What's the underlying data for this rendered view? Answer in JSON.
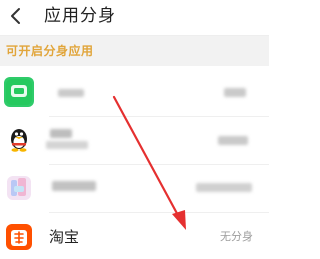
{
  "header": {
    "title": "应用分身",
    "back_icon": "back-arrow-icon"
  },
  "section": {
    "label": "可开启分身应用"
  },
  "apps": [
    {
      "name": "",
      "status": "",
      "icon": "green-chat-app-icon",
      "blurred": true
    },
    {
      "name": "",
      "status": "",
      "icon": "penguin-app-icon",
      "blurred": true
    },
    {
      "name": "",
      "status": "",
      "icon": "pastel-app-icon",
      "blurred": true
    },
    {
      "name": "淘宝",
      "status": "无分身",
      "icon": "taobao-icon",
      "blurred": false
    }
  ],
  "colors": {
    "section_label": "#e1a53a",
    "annotation_arrow": "#e53030",
    "taobao_brand": "#ff5000"
  },
  "annotation": {
    "arrow": "red-annotation-arrow-icon"
  }
}
